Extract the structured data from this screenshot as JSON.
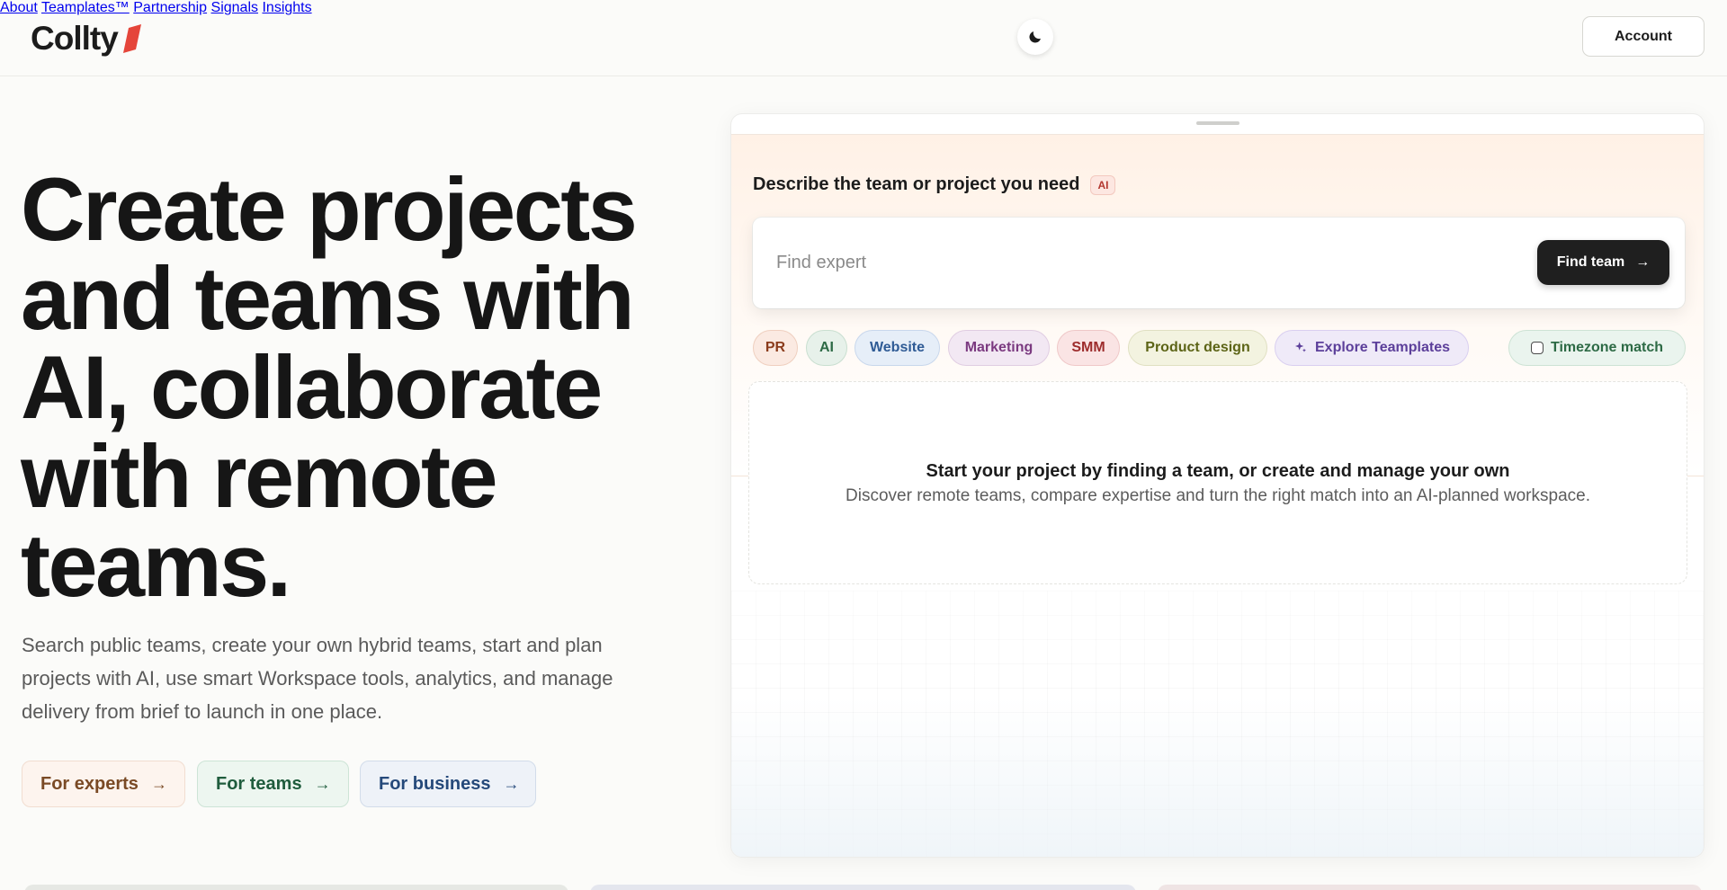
{
  "brand": {
    "name": "Collty",
    "accent": "#e5453a"
  },
  "header": {
    "theme_toggle_icon": "moon-icon",
    "nav": [
      {
        "label": "About"
      },
      {
        "label": "Teamplates™"
      },
      {
        "label": "Partnership"
      },
      {
        "label": "Signals"
      },
      {
        "label": "Insights"
      }
    ],
    "account_label": "Account"
  },
  "hero": {
    "title": "Create projects and teams with AI, collaborate with remote teams.",
    "subtitle": "Search public teams, create your own hybrid teams, start and plan projects with AI, use smart Workspace tools, analytics, and manage delivery from brief to launch in one place.",
    "cta": [
      {
        "label": "For experts",
        "color": "#7a4a25"
      },
      {
        "label": "For teams",
        "color": "#1f5c3d"
      },
      {
        "label": "For business",
        "color": "#25497a"
      }
    ]
  },
  "panel": {
    "label": "Describe the team or project you need",
    "ai_badge": "AI",
    "search": {
      "placeholder": "Find expert",
      "value": ""
    },
    "find_button": "Find team",
    "chips": [
      {
        "label": "PR"
      },
      {
        "label": "AI"
      },
      {
        "label": "Website"
      },
      {
        "label": "Marketing"
      },
      {
        "label": "SMM"
      },
      {
        "label": "Product design"
      },
      {
        "label": "Explore Teamplates",
        "icon": "sparkle-icon"
      }
    ],
    "timezone_label": "Timezone match",
    "timezone_checked": false,
    "empty": {
      "title": "Start your project by finding a team, or create and manage your own",
      "description": "Discover remote teams, compare expertise and turn the right match into an AI-planned workspace."
    }
  }
}
